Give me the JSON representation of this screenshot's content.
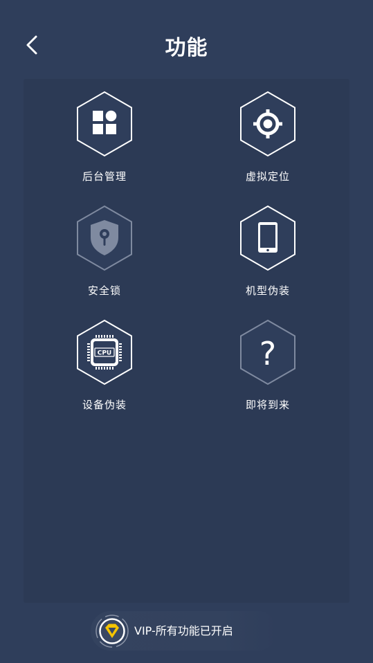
{
  "header": {
    "title": "功能",
    "back_icon": "chevron-left-icon"
  },
  "features": [
    {
      "id": "background",
      "label": "后台管理",
      "icon": "apps-grid-icon",
      "enabled": true
    },
    {
      "id": "location",
      "label": "虚拟定位",
      "icon": "crosshair-target-icon",
      "enabled": true
    },
    {
      "id": "lock",
      "label": "安全锁",
      "icon": "shield-lock-icon",
      "enabled": false
    },
    {
      "id": "model",
      "label": "机型伪装",
      "icon": "phone-icon",
      "enabled": true
    },
    {
      "id": "device",
      "label": "设备伪装",
      "icon": "cpu-chip-icon",
      "enabled": true,
      "chip_text": "CPU"
    },
    {
      "id": "coming",
      "label": "即将到来",
      "icon": "question-mark-icon",
      "enabled": false,
      "glyph": "?"
    }
  ],
  "vip": {
    "text": "VIP-所有功能已开启",
    "icon": "vip-v-badge-icon",
    "accent": "#f5c400"
  },
  "colors": {
    "background": "#2f3e5b",
    "panel": "#2c3a55",
    "icon_dim": "#7f8aa0"
  }
}
